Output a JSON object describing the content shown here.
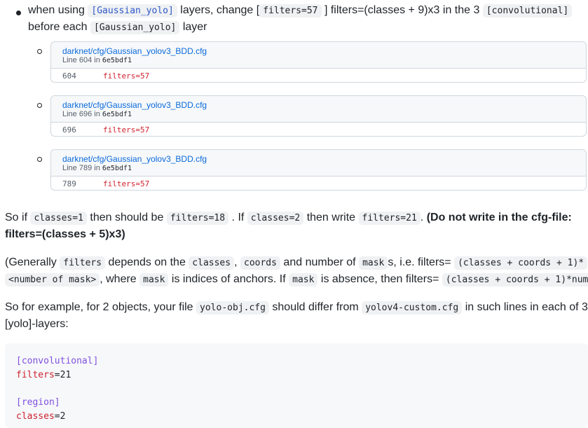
{
  "bullet": {
    "text1": "when using",
    "code1": "[Gaussian_yolo]",
    "text2": "layers, change [",
    "code2": "filters=57",
    "text3": "] filters=(classes + 9)x3 in the 3",
    "code3": "[convolutional]",
    "text4": "before each",
    "code4": "[Gaussian_yolo]",
    "text5": "layer"
  },
  "cards": [
    {
      "path": "darknet/cfg/Gaussian_yolov3_BDD.cfg",
      "line_prefix": "Line 604 in",
      "commit": "6e5bdf1",
      "line_num": "604",
      "code_key": "filters",
      "code_rest": "=57"
    },
    {
      "path": "darknet/cfg/Gaussian_yolov3_BDD.cfg",
      "line_prefix": "Line 696 in",
      "commit": "6e5bdf1",
      "line_num": "696",
      "code_key": "filters",
      "code_rest": "=57"
    },
    {
      "path": "darknet/cfg/Gaussian_yolov3_BDD.cfg",
      "line_prefix": "Line 789 in",
      "commit": "6e5bdf1",
      "line_num": "789",
      "code_key": "filters",
      "code_rest": "=57"
    }
  ],
  "p1": {
    "t1": "So if",
    "c1": "classes=1",
    "t2": "then should be",
    "c2": "filters=18",
    "t3": ". If",
    "c3": "classes=2",
    "t4": "then write",
    "c4": "filters=21",
    "t5": ".",
    "bold1": "(Do not write in the cfg-file:",
    "bold2": "filters=(classes + 5)x3)"
  },
  "p2": {
    "t1": "(Generally",
    "c1": "filters",
    "t2": "depends on the",
    "c2": "classes",
    "t3": ",",
    "c3": "coords",
    "t4": "and number of",
    "c4": "mask",
    "t5": "s, i.e. filters=",
    "c5": "(classes + coords + 1)*",
    "c6": "<number of mask>",
    "t6": ", where",
    "c7": "mask",
    "t7": "is indices of anchors. If",
    "c8": "mask",
    "t8": "is absence, then filters=",
    "c9": "(classes + coords + 1)*num",
    "t9": ")"
  },
  "p3": {
    "t1": "So for example, for 2 objects, your file",
    "c1": "yolo-obj.cfg",
    "t2": "should differ from",
    "c2": "yolov4-custom.cfg",
    "t3": "in such lines in each of 3",
    "t4": "[yolo]-layers:"
  },
  "code_block": {
    "l1": "[convolutional]",
    "l2_key": "filters",
    "l2_val": "=21",
    "l3": "[region]",
    "l4_key": "classes",
    "l4_val": "=2"
  }
}
